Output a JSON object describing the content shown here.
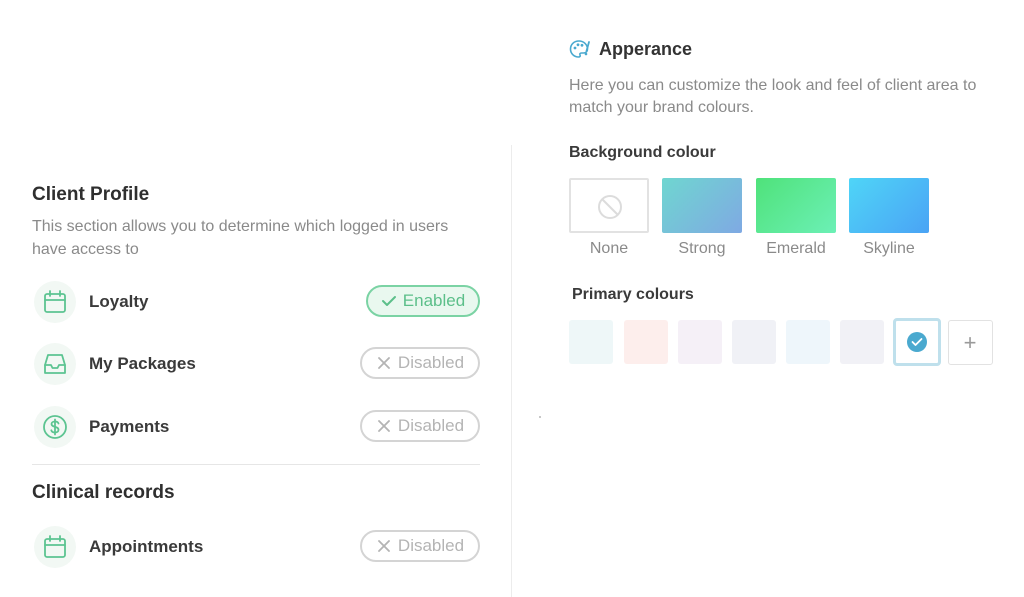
{
  "client_profile": {
    "title": "Client Profile",
    "description": "This section allows you to determine which logged in users have access to",
    "items": [
      {
        "label": "Loyalty",
        "status": "Enabled",
        "enabled": true,
        "icon": "calendar-icon"
      },
      {
        "label": "My Packages",
        "status": "Disabled",
        "enabled": false,
        "icon": "inbox-icon"
      },
      {
        "label": "Payments",
        "status": "Disabled",
        "enabled": false,
        "icon": "dollar-icon"
      }
    ]
  },
  "clinical_records": {
    "title": "Clinical records",
    "items": [
      {
        "label": "Appointments",
        "status": "Disabled",
        "enabled": false,
        "icon": "calendar-icon"
      }
    ]
  },
  "appearance": {
    "title": "Apperance",
    "icon": "palette-icon",
    "description": "Here you can customize the look and feel of client area to match your brand colours.",
    "background": {
      "title": "Background colour",
      "options": [
        {
          "label": "None",
          "colors": []
        },
        {
          "label": "Strong",
          "colors": [
            "#6fd6d0",
            "#7fa9e3"
          ]
        },
        {
          "label": "Emerald",
          "colors": [
            "#4fe27a",
            "#6cf0b6"
          ]
        },
        {
          "label": "Skyline",
          "colors": [
            "#4fd5f7",
            "#4aa3f5"
          ]
        }
      ]
    },
    "primary": {
      "title": "Primary colours",
      "swatches": [
        "#eef7f8",
        "#fdeeec",
        "#f5f0f7",
        "#f0f1f6",
        "#eef6fb",
        "#f1f1f6"
      ],
      "selected_color": "#4aa9cf",
      "add_label": "+"
    }
  },
  "colors": {
    "accent_green": "#5cbf8a",
    "icon_green": "#5cc491"
  }
}
